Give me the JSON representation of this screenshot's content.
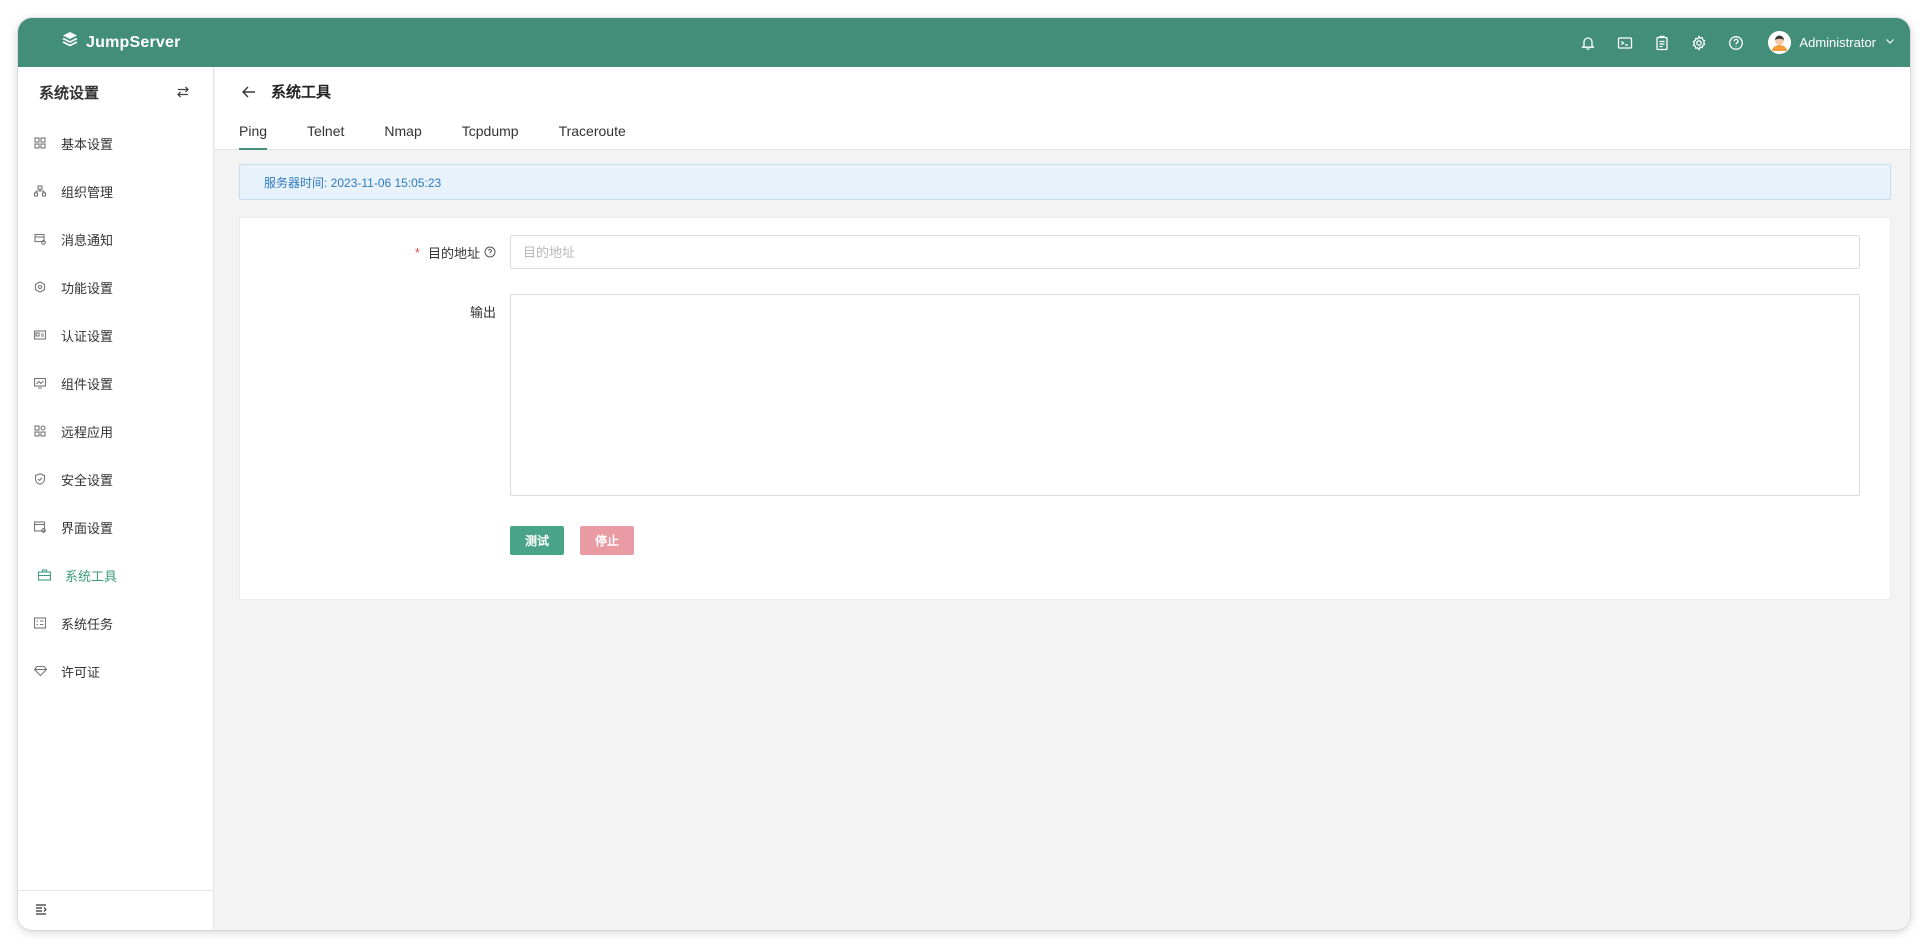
{
  "app": {
    "logo_text": "JumpServer",
    "colors": {
      "brand": "#438e79",
      "active_menu": "#3c9b7e",
      "primary_button": "#4aa588",
      "danger_button": "#e99aa3",
      "alert_text": "#2f7bbf"
    }
  },
  "topbar": {
    "icons": [
      "bell-icon",
      "terminal-icon",
      "clipboard-icon",
      "gear-icon",
      "help-icon"
    ],
    "user_name": "Administrator"
  },
  "sidebar": {
    "title": "系统设置",
    "items": [
      {
        "label": "基本设置",
        "icon": "grid-icon"
      },
      {
        "label": "组织管理",
        "icon": "org-tree-icon"
      },
      {
        "label": "消息通知",
        "icon": "message-icon"
      },
      {
        "label": "功能设置",
        "icon": "feature-icon"
      },
      {
        "label": "认证设置",
        "icon": "id-card-icon"
      },
      {
        "label": "组件设置",
        "icon": "monitor-icon"
      },
      {
        "label": "远程应用",
        "icon": "apps-icon"
      },
      {
        "label": "安全设置",
        "icon": "shield-icon"
      },
      {
        "label": "界面设置",
        "icon": "window-icon"
      },
      {
        "label": "系统工具",
        "icon": "toolbox-icon",
        "active": true
      },
      {
        "label": "系统任务",
        "icon": "tasks-icon"
      },
      {
        "label": "许可证",
        "icon": "diamond-icon"
      }
    ]
  },
  "page": {
    "title": "系统工具",
    "tabs": [
      {
        "label": "Ping",
        "active": true
      },
      {
        "label": "Telnet"
      },
      {
        "label": "Nmap"
      },
      {
        "label": "Tcpdump"
      },
      {
        "label": "Traceroute"
      }
    ],
    "alert": "服务器时间: 2023-11-06 15:05:23"
  },
  "form": {
    "dest_label": "目的地址",
    "dest_placeholder": "目的地址",
    "dest_value": "",
    "output_label": "输出",
    "output_value": "",
    "test_button": "测试",
    "stop_button": "停止"
  }
}
